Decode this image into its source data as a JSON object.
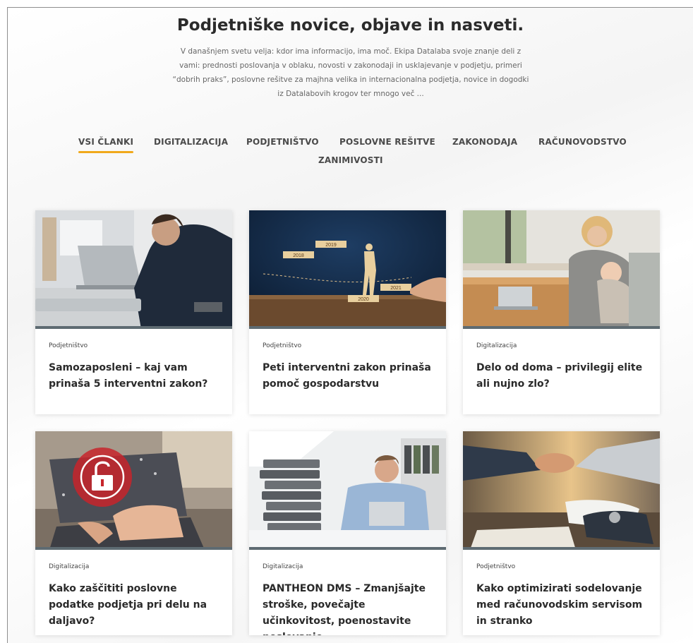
{
  "hero": {
    "title": "Podjetniške novice, objave in nasveti.",
    "description": "V današnjem svetu velja: kdor ima informacijo, ima moč. Ekipa Datalaba svoje znanje deli z vami: prednosti poslovanja v oblaku, novosti v zakonodaji in usklajevanje v podjetju, primeri “dobrih praks”, poslovne rešitve za majhna velika in internacionalna podjetja, novice in dogodki iz Datalabovih krogov ter mnogo več ..."
  },
  "tabs": [
    {
      "label": "VSI ČLANKI",
      "active": true
    },
    {
      "label": "DIGITALIZACIJA"
    },
    {
      "label": "PODJETNIŠTVO"
    },
    {
      "label": "POSLOVNE REŠITVE"
    },
    {
      "label": "ZAKONODAJA"
    },
    {
      "label": "RAČUNOVODSTVO"
    },
    {
      "label": "ZANIMIVOSTI"
    }
  ],
  "accent_color": "#f0a91c",
  "articles": [
    {
      "category": "Podjetništvo",
      "title": "Samozaposleni – kaj vam prinaša 5 interventni zakon?",
      "image": "businessman-laptop"
    },
    {
      "category": "Podjetništvo",
      "title": "Peti interventni zakon prinaša pomoč gospodarstvu",
      "image": "steps-2018-2021",
      "image_labels": [
        "2018",
        "2019",
        "2020",
        "2021"
      ]
    },
    {
      "category": "Digitalizacija",
      "title": "Delo od doma – privilegij elite ali nujno zlo?",
      "image": "mother-child-laptop"
    },
    {
      "category": "Digitalizacija",
      "title": "Kako zaščititi poslovne podatke podjetja pri delu na daljavo?",
      "image": "security-lock-laptop"
    },
    {
      "category": "Digitalizacija",
      "title": "PANTHEON DMS – Zmanjšajte stroške, povečajte učinkovitost, poenostavite poslovanje",
      "image": "man-with-binders"
    },
    {
      "category": "Podjetništvo",
      "title": "Kako optimizirati sodelovanje med računovodskim servisom in stranko",
      "image": "handshake"
    }
  ]
}
